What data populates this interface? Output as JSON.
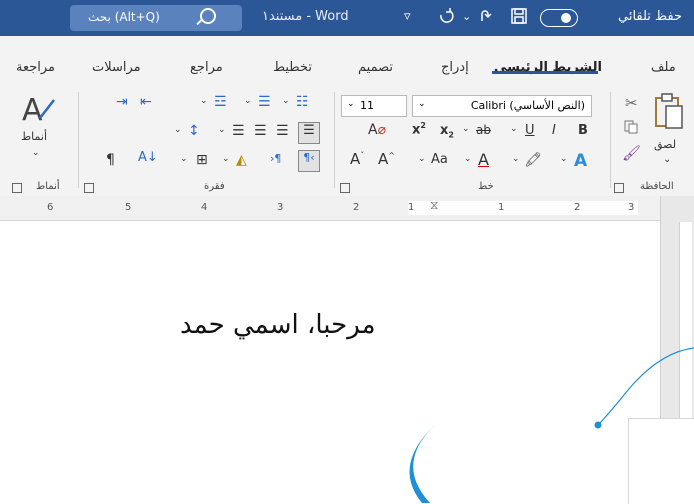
{
  "titlebar": {
    "autosave_label": "حفظ تلقائي",
    "doc_title": "مستند١ - Word",
    "search_text": "بحث (Alt+Q)"
  },
  "tabs": [
    {
      "label": "ملف"
    },
    {
      "label": "الشريط الرئيسي",
      "active": true
    },
    {
      "label": "إدراج"
    },
    {
      "label": "تصميم"
    },
    {
      "label": "تخطيط"
    },
    {
      "label": "مراجع"
    },
    {
      "label": "مراسلات"
    },
    {
      "label": "مراجعة"
    }
  ],
  "ribbon": {
    "clipboard": {
      "paste_label": "لصق",
      "group_label": "الحافظة"
    },
    "font": {
      "font_name": "(النص الأساسي) Calibri",
      "font_size": "11",
      "group_label": "خط",
      "case_label": "Aa"
    },
    "paragraph": {
      "group_label": "فقرة"
    },
    "styles": {
      "styles_label": "أنماط",
      "group_label": "أنماط"
    }
  },
  "ruler": {
    "numbers": [
      "6",
      "5",
      "4",
      "3",
      "2",
      "1",
      "1",
      "2",
      "3"
    ]
  },
  "document": {
    "text": "مرحبا، اسمي حمد"
  },
  "colors": {
    "titlebar": "#2b5797",
    "accent": "#2b579a",
    "callout": "#1e90d6"
  }
}
